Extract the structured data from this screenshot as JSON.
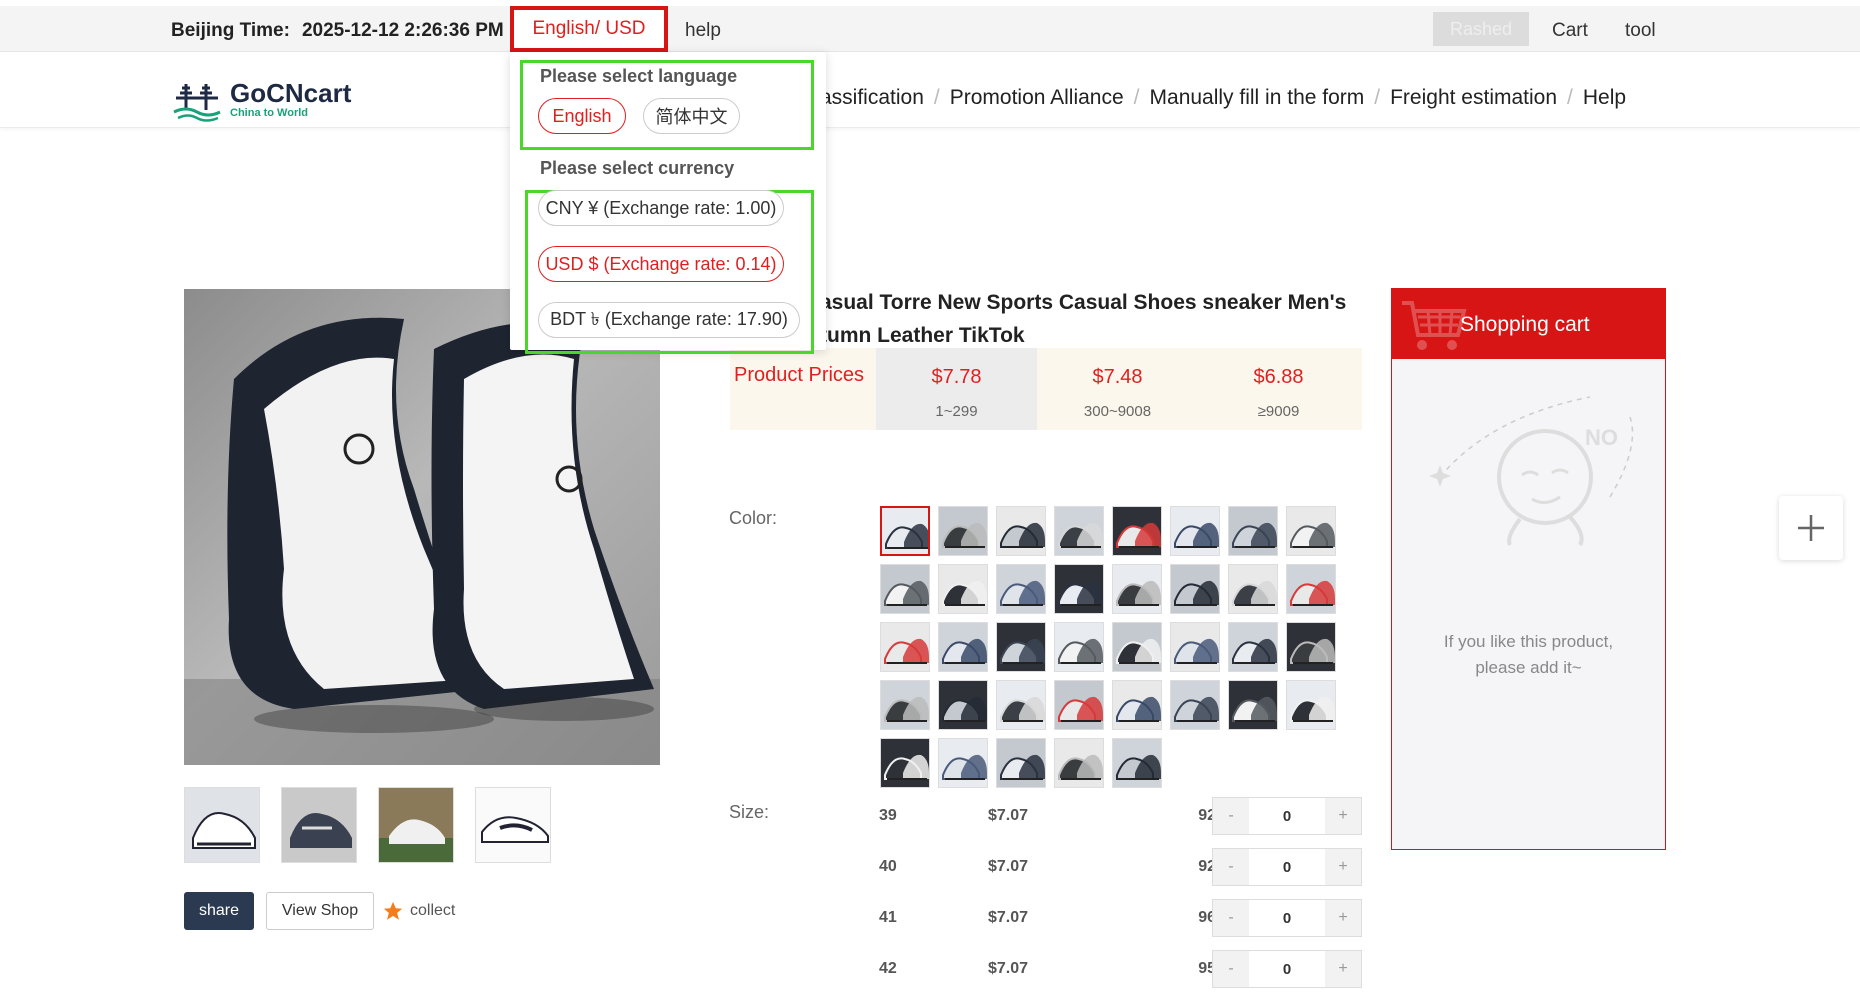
{
  "topbar": {
    "time_label": "Beijing Time:",
    "time_value": "2025-12-12 2:26:36 PM",
    "lang_currency": "English/ USD",
    "help": "help",
    "user": "Rashed",
    "cart": "Cart",
    "tool": "tool"
  },
  "header": {
    "logo_name": "GoCNcart",
    "logo_sub": "China to World",
    "nav": [
      "assification",
      "Promotion Alliance",
      "Manually fill in the form",
      "Freight estimation",
      "Help"
    ]
  },
  "dropdown": {
    "language_title": "Please select language",
    "languages": [
      "English",
      "简体中文"
    ],
    "currency_title": "Please select currency",
    "currencies": [
      "CNY ¥ (Exchange rate: 1.00)",
      "USD $ (Exchange rate: 0.14)",
      "BDT ৳ (Exchange rate: 17.90)"
    ],
    "selected_language": "English",
    "selected_currency": "USD $ (Exchange rate: 0.14)"
  },
  "product": {
    "title_line1": "asual Torre New Sports Casual Shoes sneaker Men's",
    "title_line2": "tumn Leather TikTok",
    "price_label": "Product Prices",
    "tiers": [
      {
        "price": "$7.78",
        "qty": "1~299"
      },
      {
        "price": "$7.48",
        "qty": "300~9008"
      },
      {
        "price": "$6.88",
        "qty": "≥9009"
      }
    ],
    "color_label": "Color:",
    "size_label": "Size:",
    "sizes": [
      {
        "size": "39",
        "price": "$7.07",
        "stock": "92",
        "qty": "0"
      },
      {
        "size": "40",
        "price": "$7.07",
        "stock": "92",
        "qty": "0"
      },
      {
        "size": "41",
        "price": "$7.07",
        "stock": "96",
        "qty": "0"
      },
      {
        "size": "42",
        "price": "$7.07",
        "stock": "95",
        "qty": "0"
      }
    ],
    "minus": "-",
    "plus": "+"
  },
  "actions": {
    "share": "share",
    "view_shop": "View Shop",
    "collect": "collect"
  },
  "cart": {
    "title": "Shopping cart",
    "empty_line1": "If you like this product,",
    "empty_line2": "please add it~",
    "empty_badge": "NO"
  },
  "colors": {
    "accent": "#d71515",
    "highlight": "#4ad62a",
    "nav_dark": "#2b3a50"
  }
}
